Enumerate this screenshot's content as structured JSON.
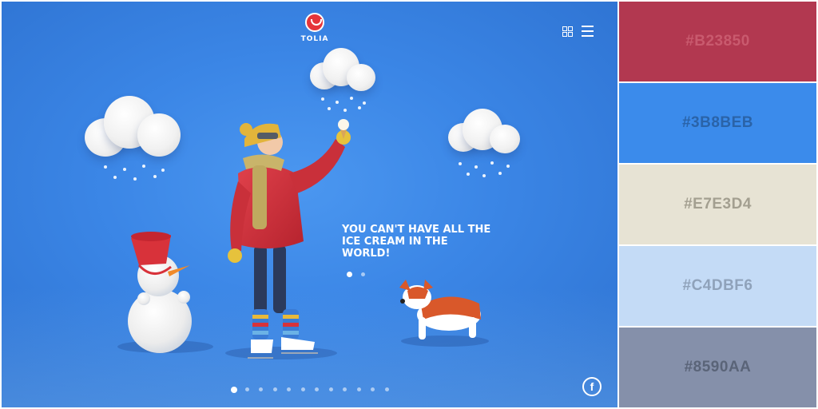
{
  "brand": {
    "name": "TOLIA",
    "logo_icon": "tolia-logo-icon",
    "logo_color": "#E5353A"
  },
  "header": {
    "grid_icon": "grid-view-icon",
    "menu_icon": "hamburger-menu-icon"
  },
  "hero": {
    "headline_lines": [
      "YOU CAN'T HAVE ALL THE",
      "ICE CREAM IN THE",
      "WORLD!"
    ],
    "background_color": "#3B8BEB",
    "illustration": "skater-snowman-dog-clouds-illustration"
  },
  "slider": {
    "slide_count": 2,
    "active_index": 0
  },
  "pagination": {
    "page_count": 12,
    "active_index": 0
  },
  "social": {
    "facebook_label": "f",
    "facebook_icon": "facebook-icon"
  },
  "palette": {
    "swatches": [
      {
        "hex": "#B23850",
        "label": "#B23850",
        "text_color": "#C95A6E"
      },
      {
        "hex": "#3B8BEB",
        "label": "#3B8BEB",
        "text_color": "#2A63A8"
      },
      {
        "hex": "#E7E3D4",
        "label": "#E7E3D4",
        "text_color": "#A39F90"
      },
      {
        "hex": "#C4DBF6",
        "label": "#C4DBF6",
        "text_color": "#8FA2BA"
      },
      {
        "hex": "#8590AA",
        "label": "#8590AA",
        "text_color": "#5A6478"
      }
    ]
  }
}
